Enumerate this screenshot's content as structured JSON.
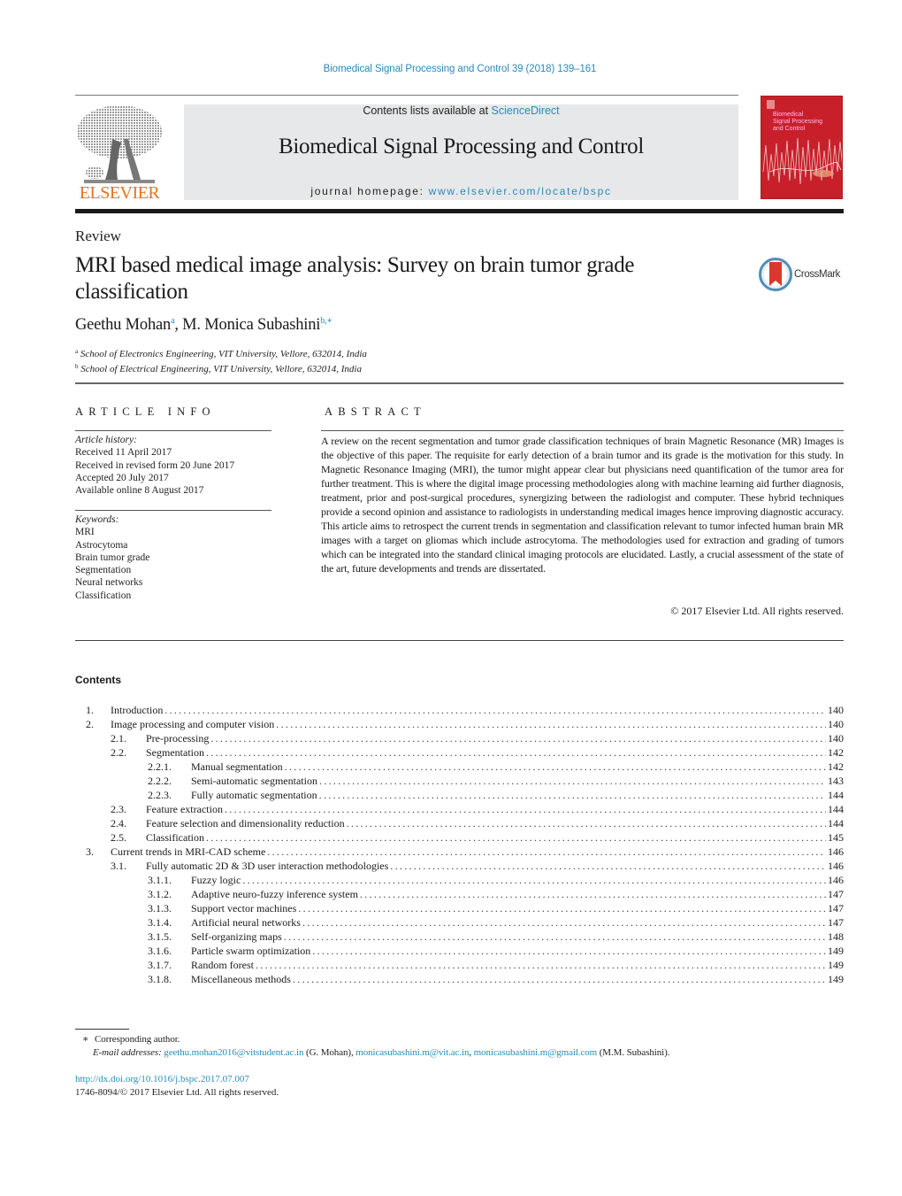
{
  "header": {
    "journal_citation": "Biomedical Signal Processing and Control 39 (2018) 139–161",
    "contents_prefix": "Contents lists available at ",
    "contents_link": "ScienceDirect",
    "journal_title": "Biomedical Signal Processing and Control",
    "homepage_prefix": "journal homepage: ",
    "homepage_link": "www.elsevier.com/locate/bspc",
    "publisher_logo_text": "ELSEVIER",
    "cover_title_lines": [
      "Biomedical",
      "Signal Processing",
      "and Control"
    ],
    "colors": {
      "link": "#2a8ab8",
      "elsevier_orange": "#e9711c",
      "cover_red": "#c8202b",
      "masthead_gray": "#e7e8e9"
    }
  },
  "article": {
    "type": "Review",
    "title": "MRI based medical image analysis: Survey on brain tumor grade classification",
    "crossmark_label": "CrossMark",
    "authors": [
      {
        "name": "Geethu Mohan",
        "marks": "a"
      },
      {
        "name": "M. Monica Subashini",
        "marks": "b,∗"
      }
    ],
    "affiliations": [
      {
        "mark": "a",
        "text": "School of Electronics Engineering, VIT University, Vellore, 632014, India"
      },
      {
        "mark": "b",
        "text": "School of Electrical Engineering, VIT University, Vellore, 632014, India"
      }
    ]
  },
  "article_info": {
    "heading": "ARTICLE INFO",
    "history_label": "Article history:",
    "history": [
      "Received 11 April 2017",
      "Received in revised form 20 June 2017",
      "Accepted 20 July 2017",
      "Available online 8 August 2017"
    ],
    "keywords_label": "Keywords:",
    "keywords": [
      "MRI",
      "Astrocytoma",
      "Brain tumor grade",
      "Segmentation",
      "Neural networks",
      "Classification"
    ]
  },
  "abstract": {
    "heading": "ABSTRACT",
    "text": "A review on the recent segmentation and tumor grade classification techniques of brain Magnetic Resonance (MR) Images is the objective of this paper. The requisite for early detection of a brain tumor and its grade is the motivation for this study. In Magnetic Resonance Imaging (MRI), the tumor might appear clear but physicians need quantification of the tumor area for further treatment. This is where the digital image processing methodologies along with machine learning aid further diagnosis, treatment, prior and post-surgical procedures, synergizing between the radiologist and computer. These hybrid techniques provide a second opinion and assistance to radiologists in understanding medical images hence improving diagnostic accuracy. This article aims to retrospect the current trends in segmentation and classification relevant to tumor infected human brain MR images with a target on gliomas which include astrocytoma. The methodologies used for extraction and grading of tumors which can be integrated into the standard clinical imaging protocols are elucidated. Lastly, a crucial assessment of the state of the art, future developments and trends are dissertated.",
    "copyright": "© 2017 Elsevier Ltd. All rights reserved."
  },
  "contents": {
    "heading": "Contents",
    "entries": [
      {
        "level": 0,
        "num": "1.",
        "title": "Introduction",
        "page": "140"
      },
      {
        "level": 0,
        "num": "2.",
        "title": "Image processing and computer vision",
        "page": "140"
      },
      {
        "level": 1,
        "num": "2.1.",
        "title": "Pre-processing",
        "page": "140"
      },
      {
        "level": 1,
        "num": "2.2.",
        "title": "Segmentation",
        "page": "142"
      },
      {
        "level": 2,
        "num": "2.2.1.",
        "title": "Manual segmentation",
        "page": "142"
      },
      {
        "level": 2,
        "num": "2.2.2.",
        "title": "Semi-automatic segmentation",
        "page": "143"
      },
      {
        "level": 2,
        "num": "2.2.3.",
        "title": "Fully automatic segmentation",
        "page": "144"
      },
      {
        "level": 1,
        "num": "2.3.",
        "title": "Feature extraction",
        "page": "144"
      },
      {
        "level": 1,
        "num": "2.4.",
        "title": "Feature selection and dimensionality reduction",
        "page": "144"
      },
      {
        "level": 1,
        "num": "2.5.",
        "title": "Classification",
        "page": "145"
      },
      {
        "level": 0,
        "num": "3.",
        "title": "Current trends in MRI-CAD scheme",
        "page": "146"
      },
      {
        "level": 1,
        "num": "3.1.",
        "title": "Fully automatic 2D & 3D user interaction methodologies",
        "page": "146"
      },
      {
        "level": 2,
        "num": "3.1.1.",
        "title": "Fuzzy logic",
        "page": "146"
      },
      {
        "level": 2,
        "num": "3.1.2.",
        "title": "Adaptive neuro-fuzzy inference system",
        "page": "147"
      },
      {
        "level": 2,
        "num": "3.1.3.",
        "title": "Support vector machines",
        "page": "147"
      },
      {
        "level": 2,
        "num": "3.1.4.",
        "title": "Artificial neural networks",
        "page": "147"
      },
      {
        "level": 2,
        "num": "3.1.5.",
        "title": "Self-organizing maps",
        "page": "148"
      },
      {
        "level": 2,
        "num": "3.1.6.",
        "title": "Particle swarm optimization",
        "page": "149"
      },
      {
        "level": 2,
        "num": "3.1.7.",
        "title": "Random forest",
        "page": "149"
      },
      {
        "level": 2,
        "num": "3.1.8.",
        "title": "Miscellaneous methods",
        "page": "149"
      }
    ]
  },
  "footer": {
    "corresponding_mark": "∗",
    "corresponding_label": "Corresponding author.",
    "email_label": "E-mail addresses:",
    "emails": [
      {
        "address": "geethu.mohan2016@vitstudent.ac.in",
        "suffix": " (G. Mohan), "
      },
      {
        "address": "monicasubashini.m@vit.ac.in",
        "suffix": ", "
      },
      {
        "address": "monicasubashini.m@gmail.com",
        "suffix": " (M.M. Subashini)."
      }
    ],
    "doi": "http://dx.doi.org/10.1016/j.bspc.2017.07.007",
    "issn_copyright": "1746-8094/© 2017 Elsevier Ltd. All rights reserved."
  }
}
